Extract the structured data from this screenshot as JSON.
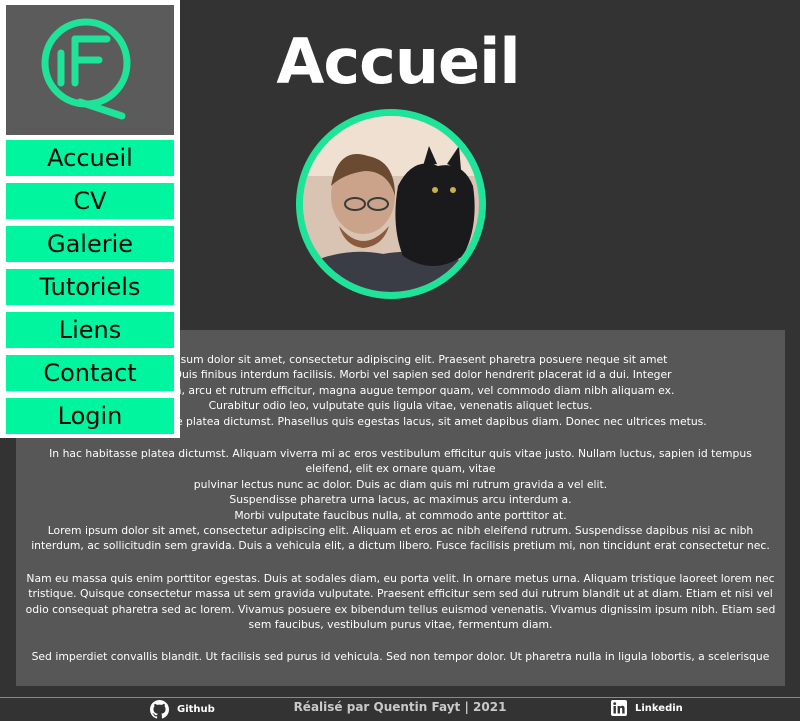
{
  "colors": {
    "background": "#333333",
    "accent": "#00f59e",
    "panel": "#575757",
    "logo_box": "#5b5b5b"
  },
  "page": {
    "title": "Accueil"
  },
  "sidebar": {
    "logo_icon": "qf-logo-icon",
    "items": [
      {
        "label": "Accueil"
      },
      {
        "label": "CV"
      },
      {
        "label": "Galerie"
      },
      {
        "label": "Tutoriels"
      },
      {
        "label": "Liens"
      },
      {
        "label": "Contact"
      },
      {
        "label": "Login"
      }
    ]
  },
  "content": {
    "paragraphs": [
      [
        "Lorem ipsum dolor sit amet, consectetur adipiscing elit. Praesent pharetra posuere neque sit amet",
        "dictum. Duis finibus interdum facilisis. Morbi vel sapien sed dolor hendrerit placerat id a dui. Integer",
        "accumsan, arcu et rutrum efficitur, magna augue tempor quam, vel commodo diam nibh aliquam ex.",
        "Curabitur odio leo, vulputate quis ligula vitae, venenatis aliquet lectus.",
        "In hac habitasse platea dictumst. Phasellus quis egestas lacus, sit amet dapibus diam. Donec nec ultrices metus."
      ],
      [
        "In hac habitasse platea dictumst. Aliquam viverra mi ac eros vestibulum efficitur quis vitae justo. Nullam luctus, sapien id tempus eleifend, elit ex ornare quam, vitae",
        "pulvinar lectus nunc ac dolor. Duis ac diam quis mi rutrum gravida a vel elit.",
        "Suspendisse pharetra urna lacus, ac maximus arcu interdum a.",
        "Morbi vulputate faucibus nulla, at commodo ante porttitor at.",
        "Lorem ipsum dolor sit amet, consectetur adipiscing elit. Aliquam et eros ac nibh eleifend rutrum. Suspendisse dapibus nisi ac nibh interdum, ac sollicitudin sem gravida. Duis a vehicula elit, a dictum libero. Fusce facilisis pretium mi, non tincidunt erat consectetur nec."
      ],
      [
        "Nam eu massa quis enim porttitor egestas. Duis at sodales diam, eu porta velit. In ornare metus urna. Aliquam tristique laoreet lorem nec tristique. Quisque consectetur massa ut sem gravida vulputate. Praesent efficitur sem sed dui rutrum blandit ut at diam. Etiam et nisi vel odio consequat pharetra sed ac lorem. Vivamus posuere ex bibendum tellus euismod venenatis. Vivamus dignissim ipsum nibh. Etiam sed sem faucibus, vestibulum purus vitae, fermentum diam."
      ],
      [
        "Sed imperdiet convallis blandit. Ut facilisis sed purus id vehicula. Sed non tempor dolor. Ut pharetra nulla in ligula lobortis, a scelerisque"
      ]
    ]
  },
  "footer": {
    "github_label": "Github",
    "github_icon": "github-icon",
    "credit": "Réalisé par Quentin Fayt | 2021",
    "linkedin_label": "Linkedin",
    "linkedin_icon": "linkedin-icon"
  }
}
